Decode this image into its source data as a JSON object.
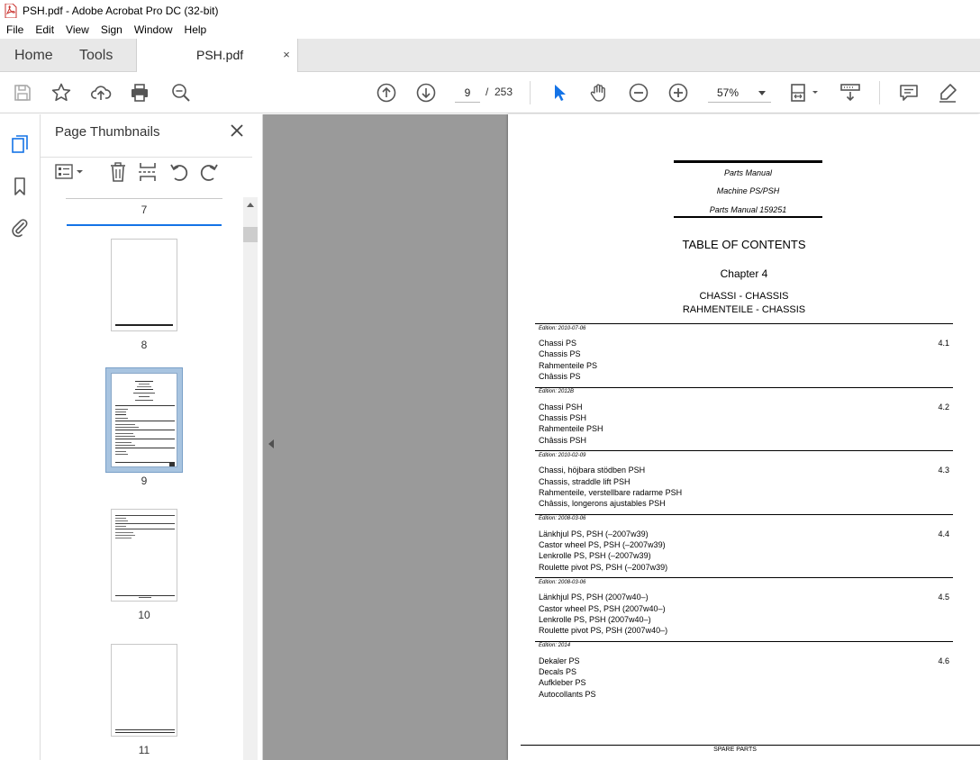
{
  "window": {
    "title": "PSH.pdf - Adobe Acrobat Pro DC (32-bit)"
  },
  "menu": {
    "items": [
      "File",
      "Edit",
      "View",
      "Sign",
      "Window",
      "Help"
    ]
  },
  "tabs": {
    "home": "Home",
    "tools": "Tools",
    "document": "PSH.pdf",
    "close": "×"
  },
  "toolbar": {
    "icons": [
      "save-icon",
      "bookmark-star-icon",
      "upload-icon",
      "print-icon",
      "zoom-search-icon",
      "page-up-icon",
      "page-down-icon",
      "select-cursor-icon",
      "hand-icon",
      "zoom-out-icon",
      "zoom-in-icon",
      "page-fit-icon",
      "scroll-mode-icon",
      "comment-icon",
      "highlight-pen-icon"
    ],
    "current_page": "9",
    "page_separator": "/",
    "total_pages": "253",
    "zoom": "57%"
  },
  "thumbnails_panel": {
    "title": "Page Thumbnails",
    "pages": [
      {
        "label": "7"
      },
      {
        "label": "8"
      },
      {
        "label": "9",
        "selected": true
      },
      {
        "label": "10"
      },
      {
        "label": "11"
      }
    ]
  },
  "document": {
    "header_lines": [
      "Parts Manual",
      "Machine PS/PSH",
      "Parts Manual 159251"
    ],
    "toc_title": "TABLE OF CONTENTS",
    "chapter": "Chapter 4",
    "section_titles": [
      "CHASSI - CHASSIS",
      "RAHMENTEILE - CHASSIS"
    ],
    "sections": [
      {
        "edition": "Edition: 2010-07-06",
        "number": "4.1",
        "lines": [
          "Chassi PS",
          "Chassis PS",
          "Rahmenteile PS",
          "Châssis PS"
        ]
      },
      {
        "edition": "Edition: 2012B",
        "number": "4.2",
        "lines": [
          "Chassi PSH",
          "Chassis PSH",
          "Rahmenteile PSH",
          "Châssis PSH"
        ]
      },
      {
        "edition": "Edition: 2010-02-09",
        "number": "4.3",
        "lines": [
          "Chassi, höjbara stödben PSH",
          "Chassis, straddle lift PSH",
          "Rahmenteile, verstellbare radarme PSH",
          "Châssis, longerons ajustables PSH"
        ]
      },
      {
        "edition": "Edition: 2008-03-06",
        "number": "4.4",
        "lines": [
          "Länkhjul PS, PSH (–2007w39)",
          "Castor wheel PS, PSH (–2007w39)",
          "Lenkrolle PS, PSH (–2007w39)",
          "Roulette pivot PS, PSH (–2007w39)"
        ]
      },
      {
        "edition": "Edition: 2008-03-06",
        "number": "4.5",
        "lines": [
          "Länkhjul PS, PSH (2007w40–)",
          "Castor wheel PS, PSH (2007w40–)",
          "Lenkrolle PS, PSH (2007w40–)",
          "Roulette pivot PS, PSH (2007w40–)"
        ]
      },
      {
        "edition": "Edition: 2014",
        "number": "4.6",
        "lines": [
          "Dekaler PS",
          "Decals PS",
          "Aufkleber PS",
          "Autocollants PS"
        ]
      }
    ],
    "footer": "SPARE PARTS"
  },
  "colors": {
    "accent_blue": "#1473e6",
    "pdf_red": "#d4302b",
    "canvas_gray": "#9a9a9a",
    "selected_thumb": "#a8c4e0"
  }
}
